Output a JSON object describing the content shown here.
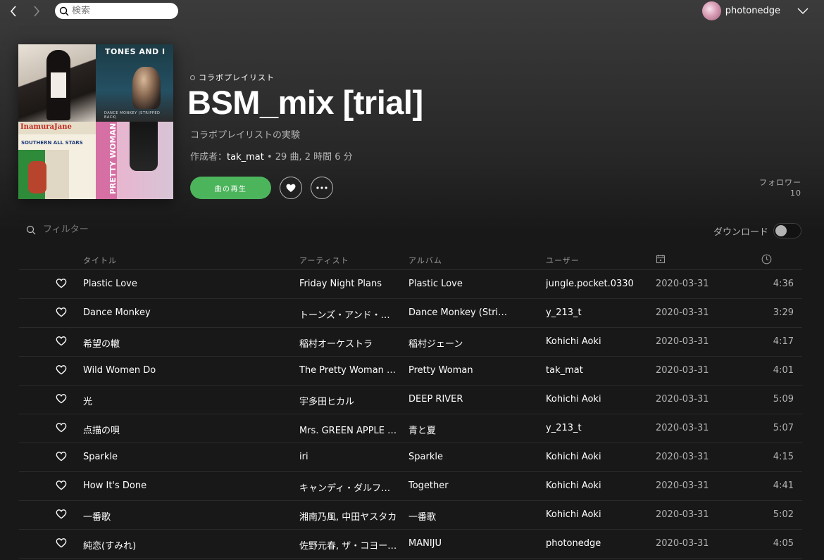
{
  "topbar": {
    "search_placeholder": "検索",
    "user_name": "photonedge"
  },
  "playlist": {
    "type_label": "コラボプレイリスト",
    "title": "BSM_mix [trial]",
    "description": "コラボプレイリストの実験",
    "meta_prefix": "作成者：",
    "owner": "tak_mat",
    "meta_suffix": " • 29 曲, 2 時間 6 分",
    "play_label": "曲の再生",
    "followers_label": "フォロワー",
    "followers_count": "10",
    "covers": [
      {
        "text": "TONES AND I",
        "subtext": "DANCE MONKEY (STRIPPED BACK)"
      },
      {
        "text": "InamuraJane",
        "subtext": "SOUTHERN ALL STARS"
      },
      {
        "text": "PRETTY WOMAN"
      }
    ]
  },
  "filter": {
    "placeholder": "フィルター"
  },
  "download": {
    "label": "ダウンロード",
    "enabled": false
  },
  "table": {
    "headers": {
      "title": "タイトル",
      "artist": "アーティスト",
      "album": "アルバム",
      "user": "ユーザー"
    },
    "rows": [
      {
        "title": "Plastic Love",
        "artist": "Friday Night Plans",
        "album": "Plastic Love",
        "user": "jungle.pocket.0330",
        "date": "2020-03-31",
        "duration": "4:36"
      },
      {
        "title": "Dance Monkey",
        "artist": "トーンズ・アンド・アイ",
        "album": "Dance Monkey (Stripped Back)",
        "user": "y_213_t",
        "date": "2020-03-31",
        "duration": "3:29"
      },
      {
        "title": "希望の轍",
        "artist": "稲村オーケストラ",
        "album": "稲村ジェーン",
        "user": "Kohichi Aoki",
        "date": "2020-03-31",
        "duration": "4:17"
      },
      {
        "title": "Wild Women Do",
        "artist": "The Pretty Woman Soundtrack",
        "album": "Pretty Woman",
        "user": "tak_mat",
        "date": "2020-03-31",
        "duration": "4:01"
      },
      {
        "title": "光",
        "artist": "宇多田ヒカル",
        "album": "DEEP RIVER",
        "user": "Kohichi Aoki",
        "date": "2020-03-31",
        "duration": "5:09"
      },
      {
        "title": "点描の唄",
        "artist": "Mrs. GREEN APPLE feat. 井上苑子",
        "album": "青と夏",
        "user": "y_213_t",
        "date": "2020-03-31",
        "duration": "5:07"
      },
      {
        "title": "Sparkle",
        "artist": "iri",
        "album": "Sparkle",
        "user": "Kohichi Aoki",
        "date": "2020-03-31",
        "duration": "4:15"
      },
      {
        "title": "How It's Done",
        "artist": "キャンディ・ダルファー",
        "album": "Together",
        "user": "Kohichi Aoki",
        "date": "2020-03-31",
        "duration": "4:41"
      },
      {
        "title": "一番歌",
        "artist": "湘南乃風, 中田ヤスタカ",
        "album": "一番歌",
        "user": "Kohichi Aoki",
        "date": "2020-03-31",
        "duration": "5:02"
      },
      {
        "title": "純恋(すみれ)",
        "artist": "佐野元春, ザ・コヨーテ・バンド",
        "album": "MANIJU",
        "user": "photonedge",
        "date": "2020-03-31",
        "duration": "4:05"
      }
    ]
  }
}
